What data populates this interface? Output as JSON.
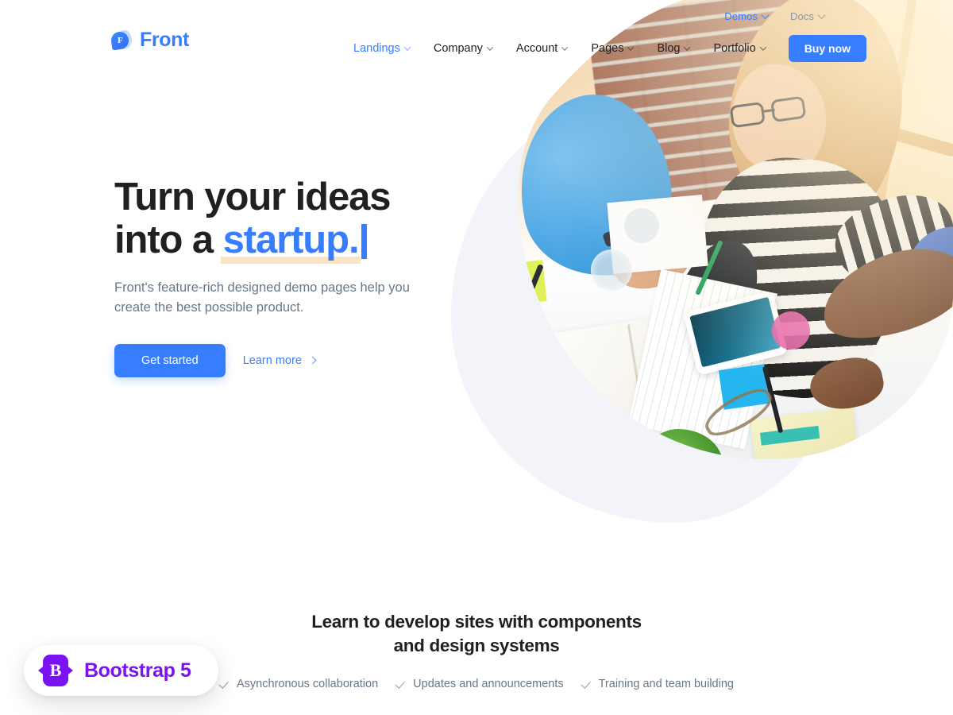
{
  "brand": {
    "name": "Front",
    "logo_icon": "front-leaf-logo-icon",
    "logo_letter": "F",
    "color": "#377dff"
  },
  "utility_nav": {
    "items": [
      {
        "label": "Demos",
        "icon": "chevron-down-icon",
        "active": true
      },
      {
        "label": "Docs",
        "icon": "chevron-down-icon",
        "active": false
      }
    ]
  },
  "main_nav": {
    "items": [
      {
        "label": "Landings",
        "icon": "chevron-down-icon",
        "active": true
      },
      {
        "label": "Company",
        "icon": "chevron-down-icon",
        "active": false
      },
      {
        "label": "Account",
        "icon": "chevron-down-icon",
        "active": false
      },
      {
        "label": "Pages",
        "icon": "chevron-down-icon",
        "active": false
      },
      {
        "label": "Blog",
        "icon": "chevron-down-icon",
        "active": false
      },
      {
        "label": "Portfolio",
        "icon": "chevron-down-icon",
        "active": false
      }
    ],
    "cta": {
      "label": "Buy now",
      "color": "#377dff"
    }
  },
  "hero": {
    "title_line1": "Turn your ideas",
    "title_line2_prefix": "into a ",
    "title_highlight": "startup.",
    "highlight_color": "#377dff",
    "highlight_underline_color": "#fbe3c3",
    "caret_icon": "text-caret-icon",
    "subtitle": "Front's feature-rich designed demo pages help you create the best possible product.",
    "primary_button": "Get started",
    "secondary_link": "Learn more",
    "secondary_link_icon": "chevron-right-icon",
    "image_alt": "Team collaborating at a white office desk with tablet, notebooks and sticky notes",
    "blob_color": "#f2f4f9"
  },
  "features_section": {
    "title_line1": "Learn to develop sites with components",
    "title_line2": "and design systems",
    "items": [
      {
        "icon": "check-icon",
        "label": "Asynchronous collaboration"
      },
      {
        "icon": "check-icon",
        "label": "Updates and announcements"
      },
      {
        "icon": "check-icon",
        "label": "Training and team building"
      }
    ]
  },
  "bootstrap_badge": {
    "label": "Bootstrap 5",
    "logo_icon": "bootstrap-logo-icon",
    "logo_letter": "B",
    "color": "#7a12f4"
  }
}
